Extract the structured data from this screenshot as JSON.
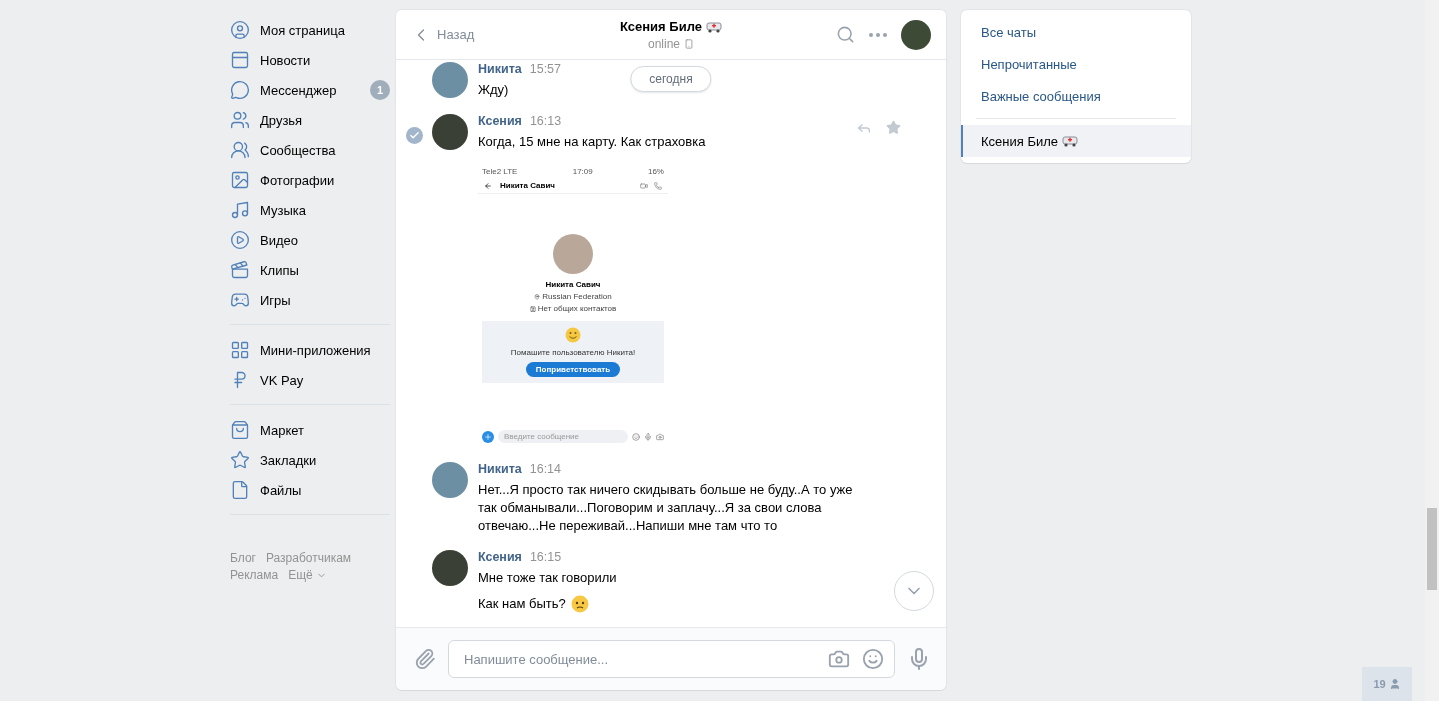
{
  "nav": {
    "groups": [
      [
        {
          "label": "Моя страница"
        },
        {
          "label": "Новости"
        },
        {
          "label": "Мессенджер",
          "badge": "1"
        },
        {
          "label": "Друзья"
        },
        {
          "label": "Сообщества"
        },
        {
          "label": "Фотографии"
        },
        {
          "label": "Музыка"
        },
        {
          "label": "Видео"
        },
        {
          "label": "Клипы"
        },
        {
          "label": "Игры"
        }
      ],
      [
        {
          "label": "Мини-приложения"
        },
        {
          "label": "VK Pay"
        }
      ],
      [
        {
          "label": "Маркет"
        },
        {
          "label": "Закладки"
        },
        {
          "label": "Файлы"
        }
      ]
    ],
    "footer": [
      "Блог",
      "Разработчикам",
      "Реклама",
      "Ещё"
    ]
  },
  "chat": {
    "back": "Назад",
    "title": "Ксения Биле",
    "status": "online",
    "date_pill": "сегодня",
    "messages": [
      {
        "author": "Никита",
        "time": "15:57",
        "selected": false,
        "paragraphs": [
          {
            "kind": "plain",
            "text": "Жду)"
          }
        ]
      },
      {
        "author": "Ксения",
        "time": "16:13",
        "selected": true,
        "paragraphs": [
          {
            "kind": "plain",
            "text": "Когда, 15 мне на карту. Как страховка"
          }
        ],
        "attachment": {
          "kind": "screenshot",
          "carrier": "Tele2 LTE",
          "clock": "17:09",
          "battery": "16%",
          "title": "Никита Савич",
          "profile_name": "Никита Савич",
          "location": "Russian Federation",
          "contacts": "Нет общих контактов",
          "prompt": "Помашите пользователю Никита!",
          "button": "Поприветствовать",
          "input_placeholder": "Введите сообщение"
        }
      },
      {
        "author": "Никита",
        "time": "16:14",
        "selected": false,
        "paragraphs": [
          {
            "kind": "plain",
            "text": "Нет...Я просто так ничего скидывать больше не буду..А то уже так обманывали...Поговорим и заплачу...Я за свои слова отвечаю...Не переживай...Напиши мне там что то"
          }
        ]
      },
      {
        "author": "Ксения",
        "time": "16:15",
        "selected": false,
        "paragraphs": [
          {
            "kind": "plain",
            "text": "Мне тоже так говорили"
          },
          {
            "kind": "with_emoji",
            "text": "Как нам быть?"
          }
        ]
      }
    ],
    "composer": {
      "placeholder": "Напишите сообщение..."
    }
  },
  "folders": [
    {
      "kind": "folder",
      "label": "Все чаты",
      "selected": false
    },
    {
      "kind": "folder",
      "label": "Непрочитанные",
      "selected": false
    },
    {
      "kind": "folder",
      "label": "Важные сообщения",
      "selected": false
    },
    {
      "kind": "chat",
      "label": "Ксения Биле",
      "selected": true
    }
  ],
  "online_count": "19"
}
